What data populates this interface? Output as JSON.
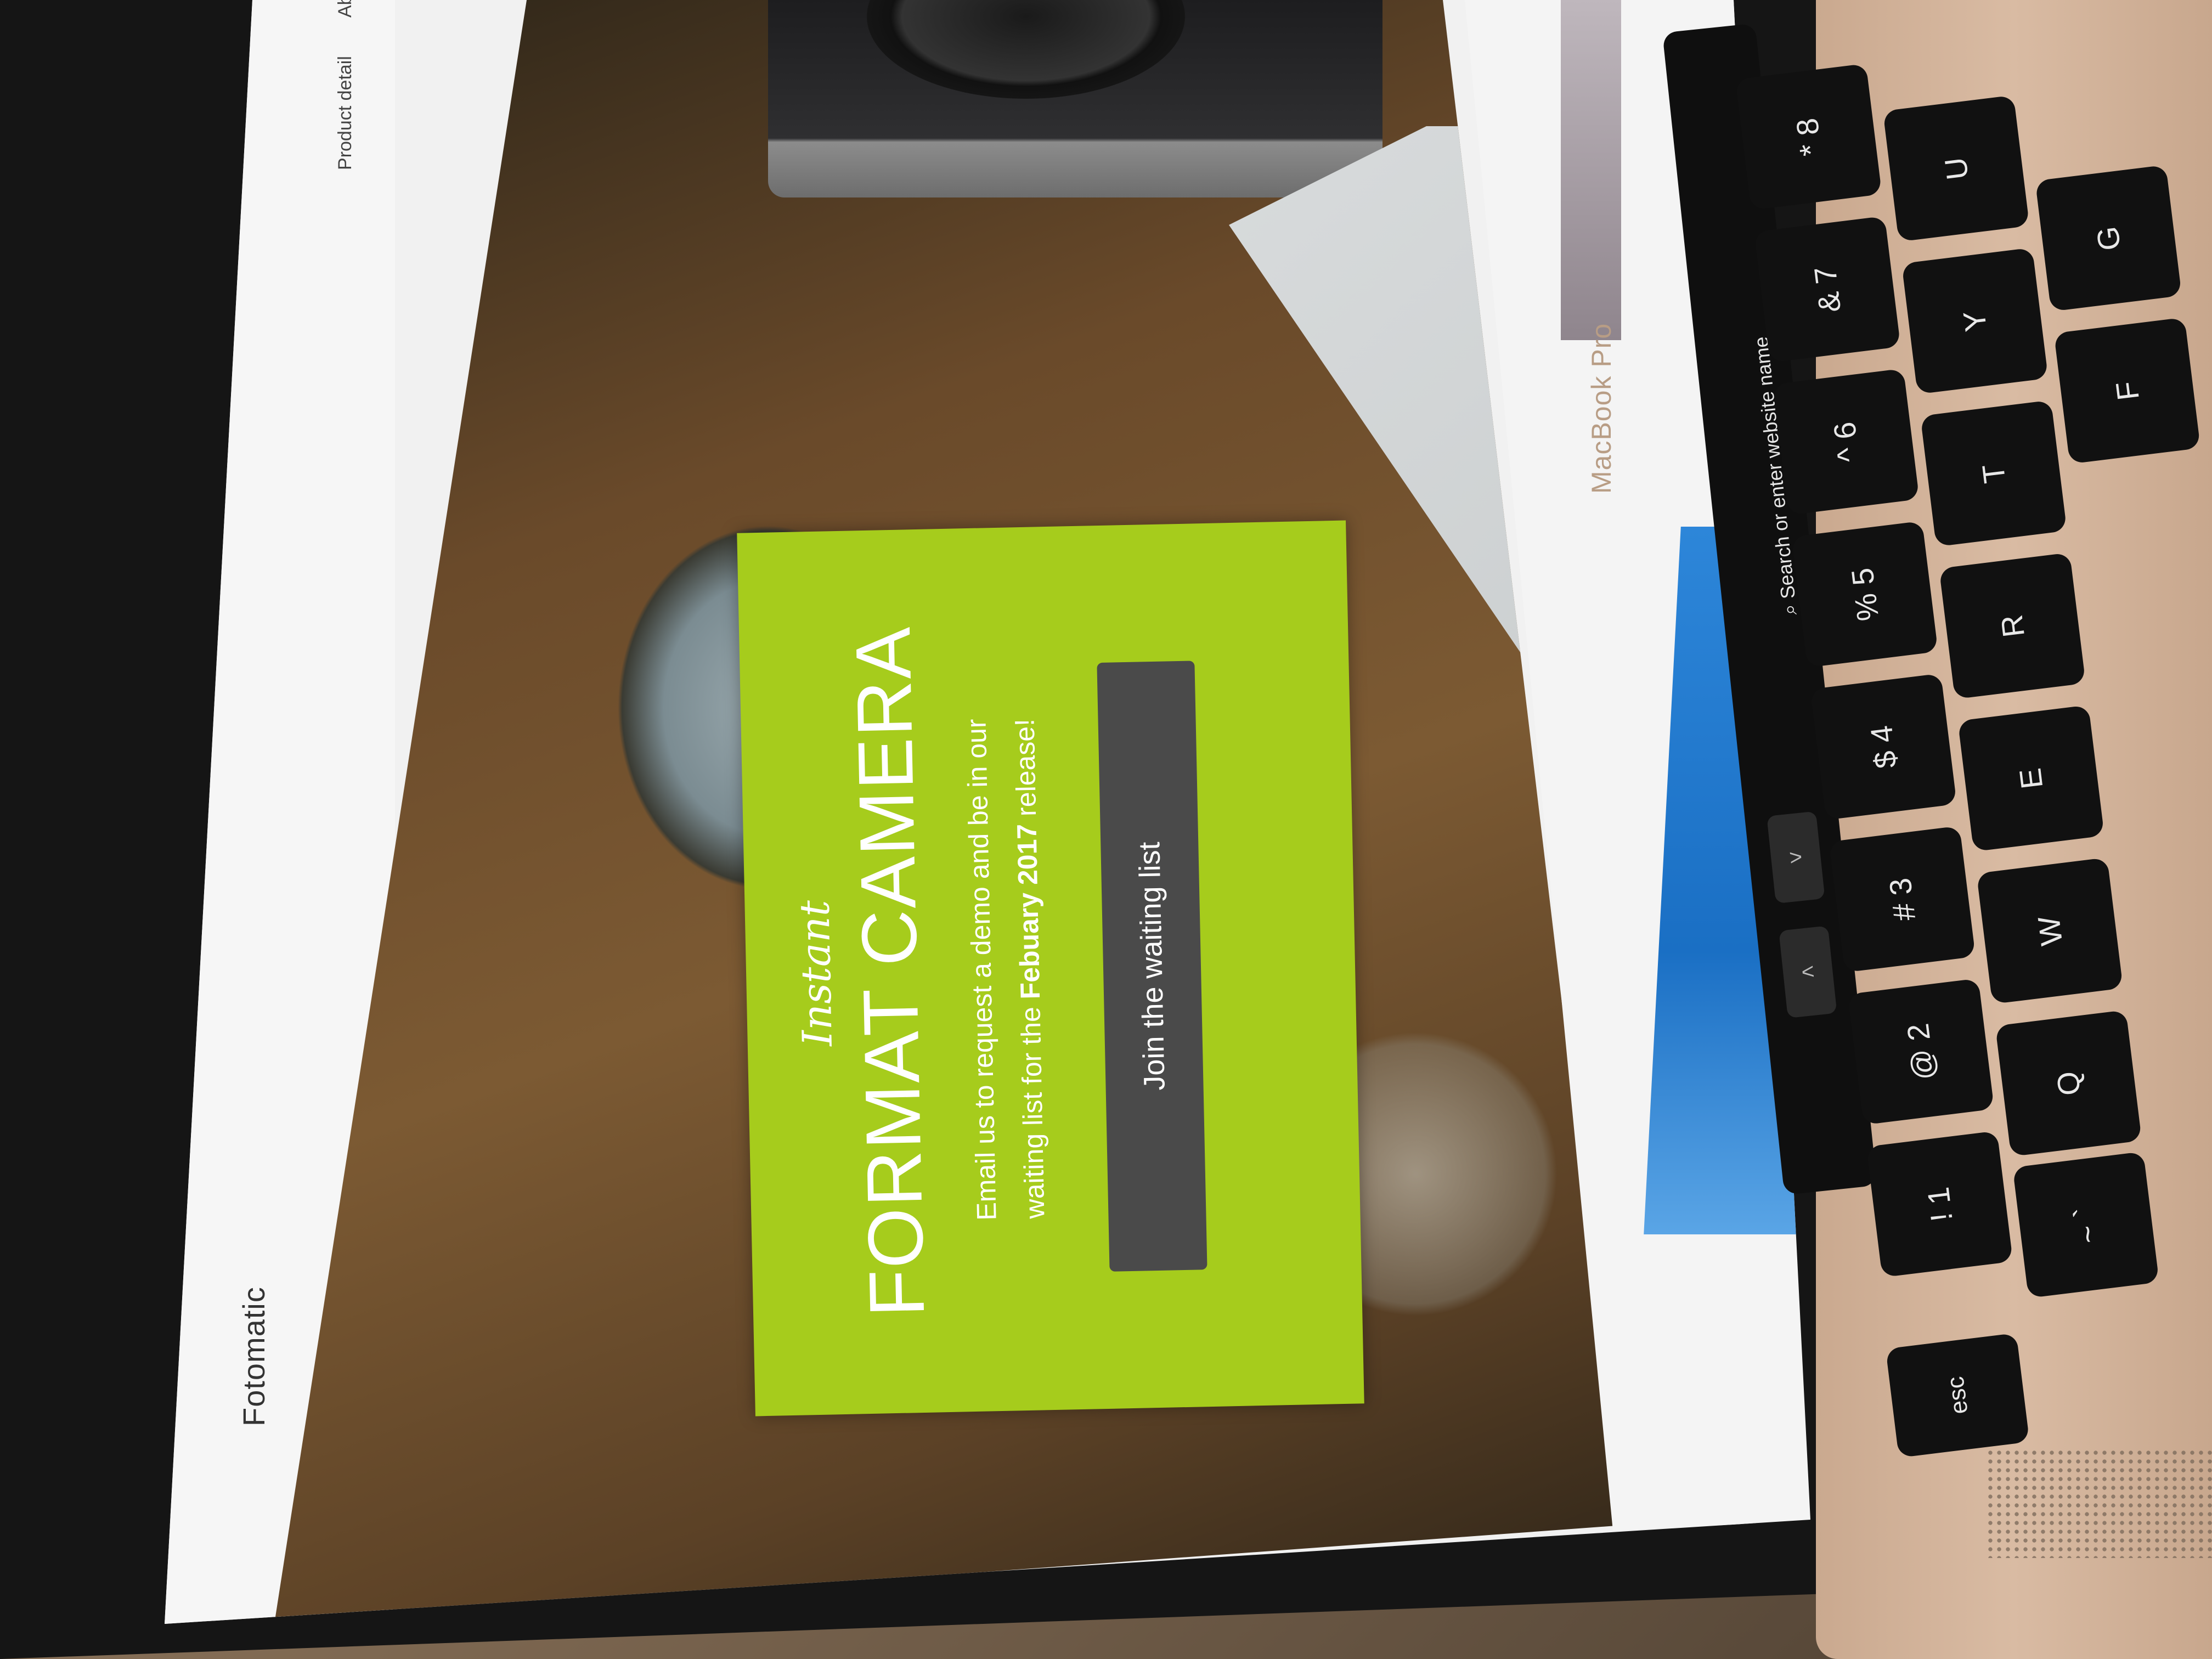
{
  "website": {
    "brand": "Fotomatic",
    "nav": [
      "Product detail",
      "Ab"
    ],
    "promo": {
      "kicker": "Instant",
      "title": "FORMAT CAMERA",
      "text_line1": "Email us to request a demo and be in our",
      "text_line2_prefix": "waiting list for the ",
      "text_line2_bold": "Febuary 2017",
      "text_line2_suffix": " release!",
      "button_label": "Join the waiting list"
    }
  },
  "device": {
    "model_label": "MacBook Pro",
    "touchbar": {
      "search_placeholder": "Search or enter website name",
      "back_label": "<",
      "forward_label": ">"
    },
    "keys": [
      {
        "label": "esc"
      },
      {
        "label": "~ `"
      },
      {
        "label": "! 1"
      },
      {
        "label": "@ 2"
      },
      {
        "label": "# 3"
      },
      {
        "label": "$ 4"
      },
      {
        "label": "% 5"
      },
      {
        "label": "^ 6"
      },
      {
        "label": "& 7"
      },
      {
        "label": "* 8"
      },
      {
        "label": "Q"
      },
      {
        "label": "W"
      },
      {
        "label": "E"
      },
      {
        "label": "R"
      },
      {
        "label": "T"
      },
      {
        "label": "Y"
      },
      {
        "label": "U"
      },
      {
        "label": "F"
      },
      {
        "label": "G"
      }
    ]
  },
  "colors": {
    "promo_green": "#a6cc1c",
    "button_gray": "#4a4a4a",
    "screen_white": "#f1f1f1",
    "key_black": "#111111",
    "laptop_gold": "#d9bba3"
  }
}
